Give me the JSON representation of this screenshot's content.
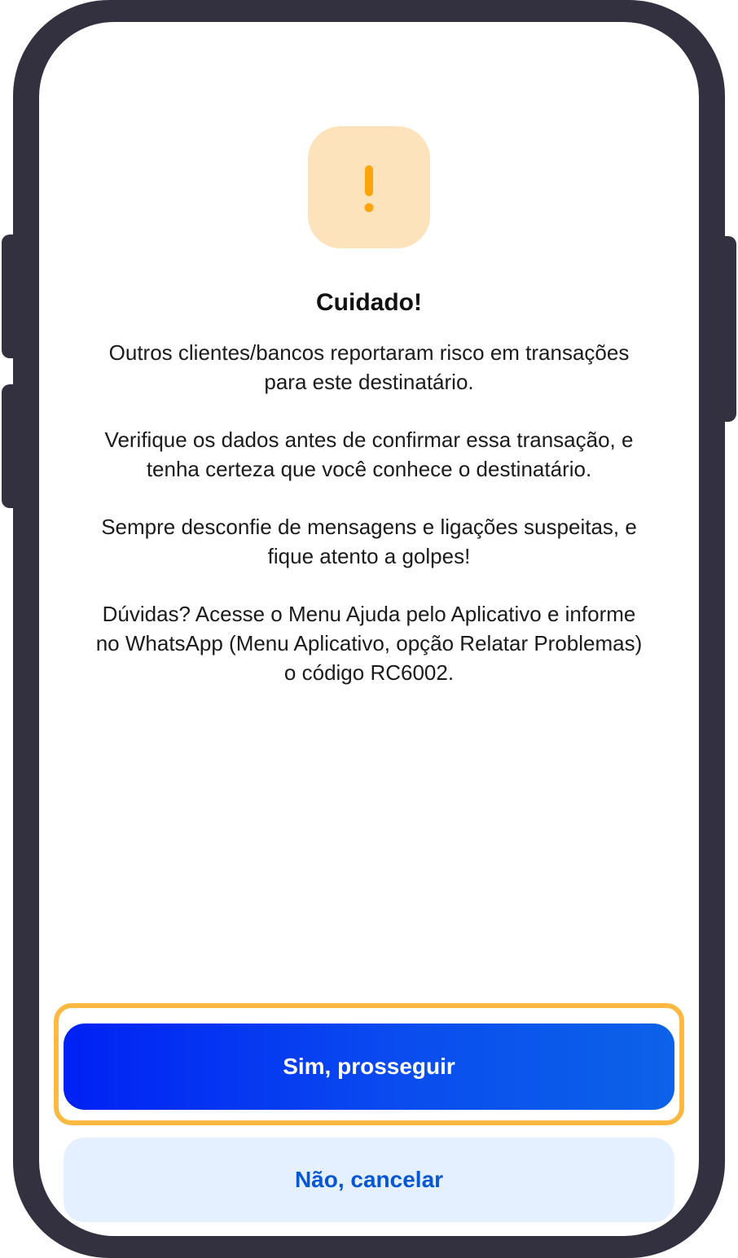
{
  "dialog": {
    "title": "Cuidado!",
    "paragraphs": [
      "Outros clientes/bancos reportaram risco em transações para este destinatário.",
      "Verifique os dados antes de confirmar essa transação, e tenha certeza que você conhece o destinatário.",
      "Sempre desconfie de mensagens e ligações suspeitas, e fique atento a golpes!",
      "Dúvidas? Acesse o Menu Ajuda pelo Aplicativo e informe no WhatsApp (Menu Aplicativo, opção Relatar Problemas) o código RC6002."
    ],
    "icon": "warning-exclamation-icon"
  },
  "actions": {
    "confirm_label": "Sim, prosseguir",
    "cancel_label": "Não, cancelar"
  },
  "colors": {
    "warning_tile": "#fde3bb",
    "warning_glyph": "#fea40b",
    "primary_gradient_start": "#0021f4",
    "primary_gradient_end": "#0c62e8",
    "secondary_bg": "#e4efff",
    "secondary_text": "#0756d4",
    "highlight_border": "#fcb941",
    "device_frame": "#33313f"
  }
}
